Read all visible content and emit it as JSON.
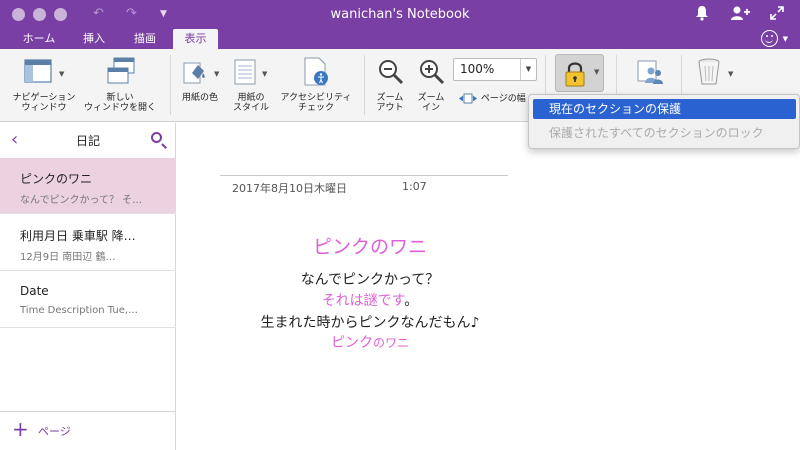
{
  "window": {
    "title": "wanichan's Notebook",
    "colors": {
      "accent": "#7a3fa5",
      "selected_page": "#ecd1e1",
      "pink_text": "#e060d9",
      "menu_highlight": "#2a62d1"
    }
  },
  "tabs": [
    "ホーム",
    "挿入",
    "描画",
    "表示"
  ],
  "active_tab": "表示",
  "ribbon": {
    "nav_window": "ナビゲーション\nウィンドウ",
    "new_window": "新しい\nウィンドウを開く",
    "paper_color": "用紙の色",
    "paper_style": "用紙の\nスタイル",
    "accessibility": "アクセシビリティ\nチェック",
    "zoom_out": "ズーム\nアウト",
    "zoom_in": "ズーム\nイン",
    "zoom_value": "100%",
    "page_width": "ページの幅"
  },
  "dropdown_menu": {
    "items": [
      {
        "label": "現在のセクションの保護",
        "state": "highlighted"
      },
      {
        "label": "保護されたすべてのセクションのロック",
        "state": "disabled"
      }
    ]
  },
  "sidebar": {
    "title": "日記",
    "pages": [
      {
        "title": "ピンクのワニ",
        "preview": "なんでピンクかって？ そ…",
        "selected": true
      },
      {
        "title": "利用月日  乗車駅    降…",
        "preview": "12月9日   南田辺      鶴…",
        "selected": false
      },
      {
        "title": "Date",
        "preview": "Time  Description  Tue,…",
        "selected": false
      }
    ],
    "add_page": "ページ"
  },
  "note": {
    "date": "2017年8月10日木曜日",
    "time": "1:07",
    "heading": "ピンクのワニ",
    "line1": "なんでピンクかって？",
    "line2": "それは謎です",
    "line2_end": "。",
    "line3": "生まれた時からピンクなんだもん♪",
    "sig_a": "ピンク",
    "sig_b": "のワニ"
  }
}
